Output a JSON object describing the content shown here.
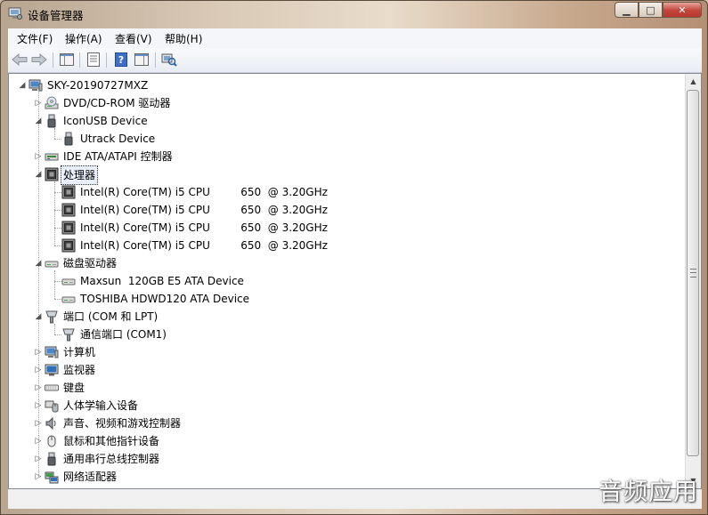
{
  "window": {
    "title": "设备管理器",
    "caption_buttons": {
      "minimize": "▁",
      "maximize": "□",
      "close": "✕"
    }
  },
  "menu": [
    "文件(F)",
    "操作(A)",
    "查看(V)",
    "帮助(H)"
  ],
  "toolbar": {
    "buttons": [
      "back-arrow-icon",
      "forward-arrow-icon",
      "show-hide-console-tree-icon",
      "properties-icon",
      "help-icon",
      "action-pane-icon",
      "scan-hardware-icon"
    ]
  },
  "tree": {
    "root": "SKY-20190727MXZ",
    "nodes": [
      {
        "label": "DVD/CD-ROM 驱动器",
        "icon": "dvd-drive-icon",
        "expanded": false,
        "children": []
      },
      {
        "label": "IconUSB Device",
        "icon": "usb-device-icon",
        "expanded": true,
        "children": [
          {
            "label": "Utrack Device",
            "icon": "usb-device-icon"
          }
        ]
      },
      {
        "label": "IDE ATA/ATAPI 控制器",
        "icon": "ide-controller-icon",
        "expanded": false,
        "children": []
      },
      {
        "label": "处理器",
        "icon": "processor-icon",
        "expanded": true,
        "selected": true,
        "children": [
          {
            "label": "Intel(R) Core(TM) i5 CPU         650  @ 3.20GHz",
            "icon": "processor-icon"
          },
          {
            "label": "Intel(R) Core(TM) i5 CPU         650  @ 3.20GHz",
            "icon": "processor-icon"
          },
          {
            "label": "Intel(R) Core(TM) i5 CPU         650  @ 3.20GHz",
            "icon": "processor-icon"
          },
          {
            "label": "Intel(R) Core(TM) i5 CPU         650  @ 3.20GHz",
            "icon": "processor-icon"
          }
        ]
      },
      {
        "label": "磁盘驱动器",
        "icon": "disk-drive-icon",
        "expanded": true,
        "children": [
          {
            "label": "Maxsun  120GB E5 ATA Device",
            "icon": "disk-drive-icon"
          },
          {
            "label": "TOSHIBA HDWD120 ATA Device",
            "icon": "disk-drive-icon"
          }
        ]
      },
      {
        "label": "端口 (COM 和 LPT)",
        "icon": "port-icon",
        "expanded": true,
        "children": [
          {
            "label": "通信端口 (COM1)",
            "icon": "port-icon"
          }
        ]
      },
      {
        "label": "计算机",
        "icon": "computer-icon",
        "expanded": false,
        "children": []
      },
      {
        "label": "监视器",
        "icon": "monitor-icon",
        "expanded": false,
        "children": []
      },
      {
        "label": "键盘",
        "icon": "keyboard-icon",
        "expanded": false,
        "children": []
      },
      {
        "label": "人体学输入设备",
        "icon": "hid-icon",
        "expanded": false,
        "children": []
      },
      {
        "label": "声音、视频和游戏控制器",
        "icon": "sound-icon",
        "expanded": false,
        "children": []
      },
      {
        "label": "鼠标和其他指针设备",
        "icon": "mouse-icon",
        "expanded": false,
        "children": []
      },
      {
        "label": "通用串行总线控制器",
        "icon": "usb-controller-icon",
        "expanded": false,
        "children": []
      },
      {
        "label": "网络适配器",
        "icon": "network-adapter-icon",
        "expanded": false,
        "children": []
      }
    ]
  },
  "watermark": "音频应用"
}
